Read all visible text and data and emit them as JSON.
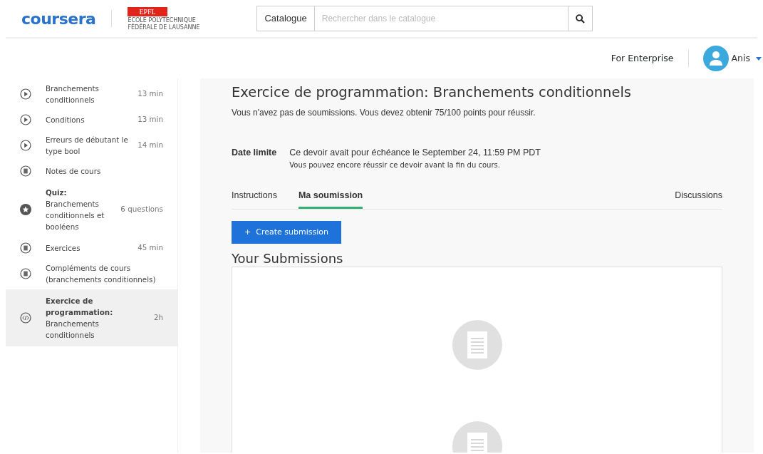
{
  "header": {
    "logo": "coursera",
    "partner_logo": {
      "mark": "EPFL",
      "line_1": "ÉCOLE POLYTECHNIQUE",
      "line_2": "FÉDÉRALE DE LAUSANNE"
    },
    "search": {
      "scope": "Catalogue",
      "placeholder": "Rechercher dans le catalogue"
    }
  },
  "subheader": {
    "link": "For Enterprise",
    "user": "Anis"
  },
  "sidebar": {
    "items": [
      {
        "kind": "video",
        "title": "Branchements conditionnels",
        "duration": "13 min",
        "selected": false
      },
      {
        "kind": "video",
        "title": "Conditions",
        "duration": "13 min",
        "selected": false
      },
      {
        "kind": "video",
        "title": "Erreurs de débutant le type bool",
        "duration": "14 min",
        "selected": false
      },
      {
        "kind": "reading",
        "title": "Notes de cours",
        "selected": false
      },
      {
        "kind": "quiz",
        "label": "Quiz:",
        "title": "Branchements conditionnels et booléens",
        "duration": "6 questions",
        "selected": false
      },
      {
        "kind": "reading",
        "title": "Exercices",
        "duration": "45 min",
        "selected": false
      },
      {
        "kind": "reading",
        "title": "Compléments de cours (branchements conditionnels)",
        "selected": false
      },
      {
        "kind": "code",
        "label": "Exercice de programmation:",
        "title": "Branchements conditionnels",
        "duration": "2h",
        "selected": true
      }
    ]
  },
  "main": {
    "title": "Exercice de programmation: Branchements conditionnels",
    "summary": "Vous n'avez pas de soumissions. Vous devez obtenir 75/100 points pour réussir.",
    "deadline": {
      "label": "Date limite",
      "text": "Ce devoir avait pour échéance le September 24, 11:59 PM PDT",
      "note": "Vous pouvez encore réussir ce devoir avant la fin du cours."
    },
    "tabs": [
      {
        "label": "Instructions",
        "selected": false
      },
      {
        "label": "Ma soumission",
        "selected": true
      },
      {
        "label": "Discussions",
        "selected": false
      }
    ],
    "button": {
      "icon": "+",
      "label": "Create submission"
    },
    "submissions_title": "Your Submissions"
  }
}
